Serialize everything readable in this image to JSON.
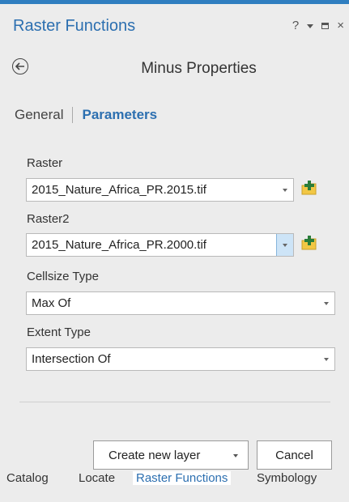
{
  "window": {
    "title": "Raster Functions",
    "controls": {
      "help": "?",
      "close": "×"
    }
  },
  "function_title": "Minus Properties",
  "tabs": {
    "general": "General",
    "parameters": "Parameters"
  },
  "fields": {
    "raster": {
      "label": "Raster",
      "value": "2015_Nature_Africa_PR.2015.tif"
    },
    "raster2": {
      "label": "Raster2",
      "value": "2015_Nature_Africa_PR.2000.tif"
    },
    "cellsize_type": {
      "label": "Cellsize Type",
      "value": "Max Of"
    },
    "extent_type": {
      "label": "Extent Type",
      "value": "Intersection Of"
    }
  },
  "buttons": {
    "create": "Create new layer",
    "cancel": "Cancel"
  },
  "bottom_tabs": [
    "Catalog",
    "Locate",
    "Raster Functions",
    "Symbology"
  ],
  "colors": {
    "accent": "#2c6fb0",
    "topbar": "#2f7ec0",
    "folder": "#f2c744",
    "plus": "#2a7d3a"
  }
}
